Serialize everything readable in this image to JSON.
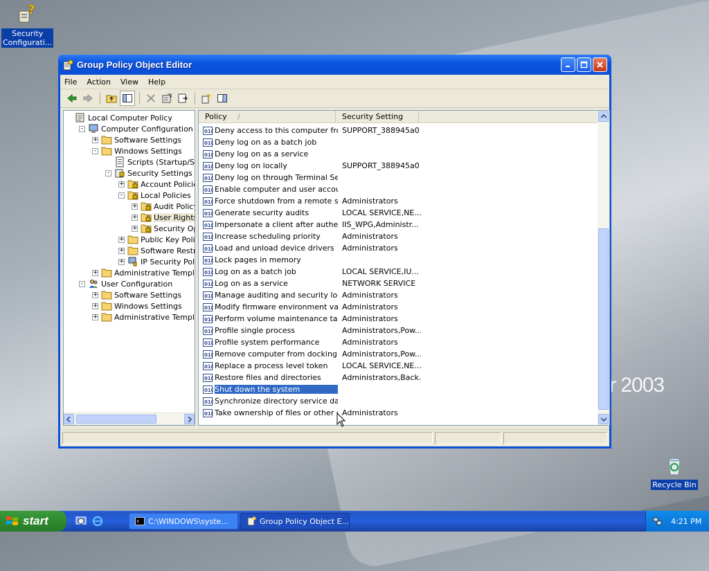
{
  "desktop": {
    "wallpaper_text": "r 2003",
    "icons": [
      {
        "label": "Security Configurati...",
        "icon": "security-config-icon"
      },
      {
        "label": "Recycle Bin",
        "icon": "recycle-bin-icon"
      }
    ]
  },
  "window": {
    "title": "Group Policy Object Editor",
    "menu": [
      "File",
      "Action",
      "View",
      "Help"
    ],
    "toolbar_icons": [
      "back-icon",
      "forward-icon",
      "up-folder-icon",
      "show-hide-tree-icon",
      "delete-icon",
      "properties-icon",
      "export-list-icon",
      "help-icon",
      "show-hide-pane-icon"
    ]
  },
  "tree": [
    {
      "label": "Local Computer Policy",
      "level": 0,
      "expander": "",
      "icon": "policy-scroll-icon"
    },
    {
      "label": "Computer Configuration",
      "level": 1,
      "expander": "-",
      "icon": "computer-icon"
    },
    {
      "label": "Software Settings",
      "level": 2,
      "expander": "+",
      "icon": "folder-icon"
    },
    {
      "label": "Windows Settings",
      "level": 2,
      "expander": "-",
      "icon": "folder-icon"
    },
    {
      "label": "Scripts (Startup/Shutdown)",
      "level": 3,
      "expander": "",
      "icon": "scripts-icon"
    },
    {
      "label": "Security Settings",
      "level": 3,
      "expander": "-",
      "icon": "security-settings-icon"
    },
    {
      "label": "Account Policies",
      "level": 4,
      "expander": "+",
      "icon": "folder-lock-icon"
    },
    {
      "label": "Local Policies",
      "level": 4,
      "expander": "-",
      "icon": "folder-lock-icon"
    },
    {
      "label": "Audit Policy",
      "level": 5,
      "expander": "+",
      "icon": "folder-lock-icon"
    },
    {
      "label": "User Rights Assignment",
      "level": 5,
      "expander": "+",
      "icon": "folder-lock-icon",
      "selected": true
    },
    {
      "label": "Security Options",
      "level": 5,
      "expander": "+",
      "icon": "folder-lock-icon"
    },
    {
      "label": "Public Key Policies",
      "level": 4,
      "expander": "+",
      "icon": "folder-icon"
    },
    {
      "label": "Software Restriction Policies",
      "level": 4,
      "expander": "+",
      "icon": "folder-icon"
    },
    {
      "label": "IP Security Policies",
      "level": 4,
      "expander": "+",
      "icon": "ip-security-icon"
    },
    {
      "label": "Administrative Templates",
      "level": 2,
      "expander": "+",
      "icon": "folder-icon"
    },
    {
      "label": "User Configuration",
      "level": 1,
      "expander": "-",
      "icon": "users-icon"
    },
    {
      "label": "Software Settings",
      "level": 2,
      "expander": "+",
      "icon": "folder-icon"
    },
    {
      "label": "Windows Settings",
      "level": 2,
      "expander": "+",
      "icon": "folder-icon"
    },
    {
      "label": "Administrative Templates",
      "level": 2,
      "expander": "+",
      "icon": "folder-icon"
    }
  ],
  "list": {
    "columns": [
      "Policy",
      "Security Setting"
    ],
    "sort_indicator": "/",
    "rows": [
      {
        "policy": "Deny access to this computer fro...",
        "setting": "SUPPORT_388945a0"
      },
      {
        "policy": "Deny log on as a batch job",
        "setting": ""
      },
      {
        "policy": "Deny log on as a service",
        "setting": ""
      },
      {
        "policy": "Deny log on locally",
        "setting": "SUPPORT_388945a0"
      },
      {
        "policy": "Deny log on through Terminal Ser...",
        "setting": ""
      },
      {
        "policy": "Enable computer and user accoun...",
        "setting": ""
      },
      {
        "policy": "Force shutdown from a remote sy...",
        "setting": "Administrators"
      },
      {
        "policy": "Generate security audits",
        "setting": "LOCAL SERVICE,NE..."
      },
      {
        "policy": "Impersonate a client after authen...",
        "setting": "IIS_WPG,Administr..."
      },
      {
        "policy": "Increase scheduling priority",
        "setting": "Administrators"
      },
      {
        "policy": "Load and unload device drivers",
        "setting": "Administrators"
      },
      {
        "policy": "Lock pages in memory",
        "setting": ""
      },
      {
        "policy": "Log on as a batch job",
        "setting": "LOCAL SERVICE,IU..."
      },
      {
        "policy": "Log on as a service",
        "setting": "NETWORK SERVICE"
      },
      {
        "policy": "Manage auditing and security log",
        "setting": "Administrators"
      },
      {
        "policy": "Modify firmware environment values",
        "setting": "Administrators"
      },
      {
        "policy": "Perform volume maintenance tasks",
        "setting": "Administrators"
      },
      {
        "policy": "Profile single process",
        "setting": "Administrators,Pow..."
      },
      {
        "policy": "Profile system performance",
        "setting": "Administrators"
      },
      {
        "policy": "Remove computer from docking st...",
        "setting": "Administrators,Pow..."
      },
      {
        "policy": "Replace a process level token",
        "setting": "LOCAL SERVICE,NE..."
      },
      {
        "policy": "Restore files and directories",
        "setting": "Administrators,Back..."
      },
      {
        "policy": "Shut down the system",
        "setting": "",
        "selected": true
      },
      {
        "policy": "Synchronize directory service data",
        "setting": ""
      },
      {
        "policy": "Take ownership of files or other o...",
        "setting": "Administrators"
      }
    ]
  },
  "taskbar": {
    "start_label": "start",
    "quick_launch": [
      "show-desktop-icon",
      "internet-explorer-icon"
    ],
    "tasks": [
      {
        "label": "C:\\WINDOWS\\syste...",
        "icon": "cmd-icon",
        "active": false
      },
      {
        "label": "Group Policy Object E...",
        "icon": "gpedit-icon",
        "active": true
      }
    ],
    "tray_icons": [
      "network-icon"
    ],
    "clock": "4:21 PM"
  },
  "colors": {
    "title_blue": "#0a4fd8",
    "selection_blue": "#316ac5",
    "start_green": "#2f8a2f",
    "window_face": "#ece9d8"
  }
}
